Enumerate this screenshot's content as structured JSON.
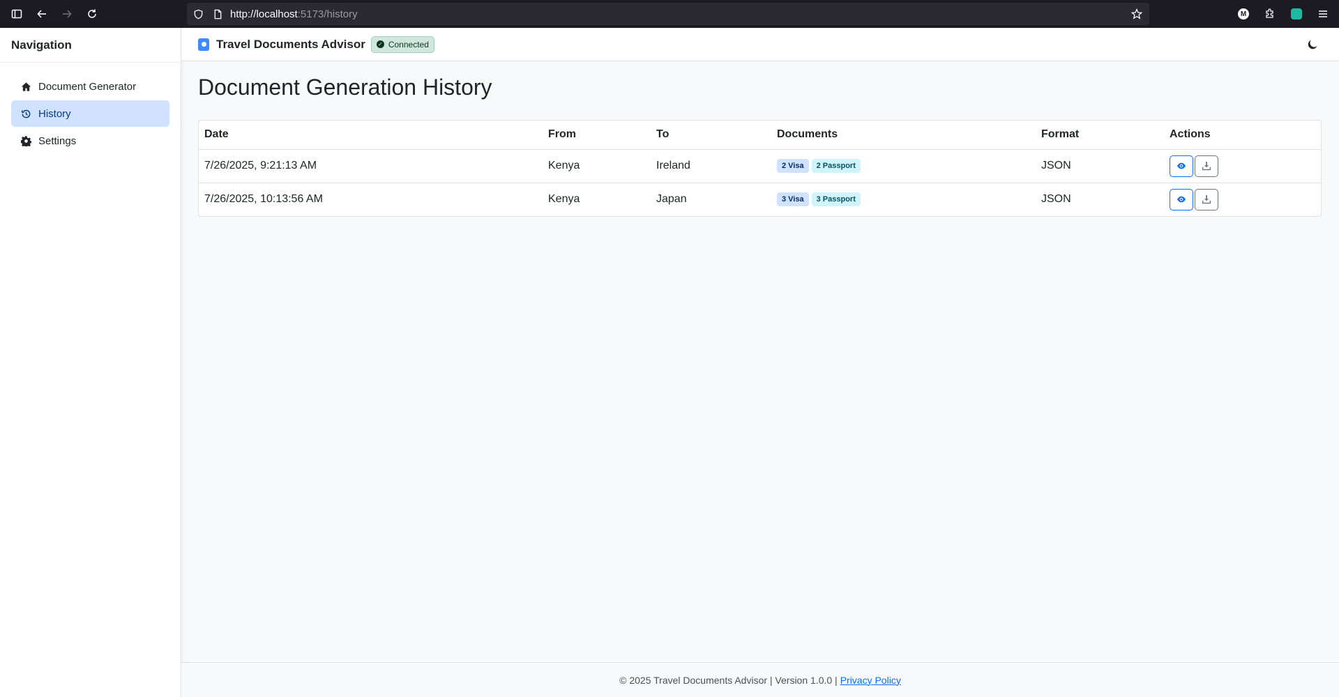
{
  "browser": {
    "url_host": "http://localhost",
    "url_rest": ":5173/history",
    "extension_badge": "M"
  },
  "sidebar": {
    "title": "Navigation",
    "items": [
      {
        "label": "Document Generator",
        "icon": "home-icon",
        "active": false
      },
      {
        "label": "History",
        "icon": "history-icon",
        "active": true
      },
      {
        "label": "Settings",
        "icon": "gear-icon",
        "active": false
      }
    ]
  },
  "header": {
    "title": "Travel Documents Advisor",
    "status": "Connected",
    "status_color": "#d1e7dd"
  },
  "main": {
    "title": "Document Generation History",
    "columns": [
      "Date",
      "From",
      "To",
      "Documents",
      "Format",
      "Actions"
    ],
    "rows": [
      {
        "date": "7/26/2025, 9:21:13 AM",
        "from": "Kenya",
        "to": "Ireland",
        "visa": "2 Visa",
        "passport": "2 Passport",
        "format": "JSON"
      },
      {
        "date": "7/26/2025, 10:13:56 AM",
        "from": "Kenya",
        "to": "Japan",
        "visa": "3 Visa",
        "passport": "3 Passport",
        "format": "JSON"
      }
    ]
  },
  "footer": {
    "text": "© 2025 Travel Documents Advisor | Version 1.0.0 |",
    "link": "Privacy Policy"
  },
  "colors": {
    "primary": "#0d6efd",
    "active_nav_bg": "#cfe2ff"
  }
}
